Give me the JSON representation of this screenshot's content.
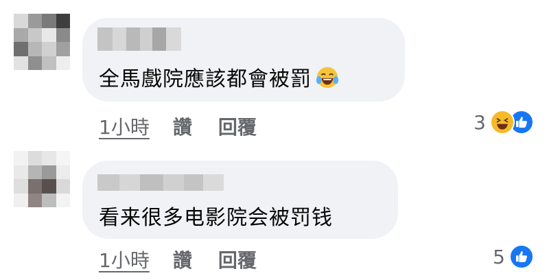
{
  "comments": [
    {
      "text": "全馬戲院應該都會被罰",
      "time": "1小時",
      "like_label": "讚",
      "reply_label": "回覆",
      "reaction_count": "3",
      "reactions": [
        "haha-icon",
        "like-icon"
      ],
      "inline_emoji": "laughing-tears-icon"
    },
    {
      "text": "看来很多电影院会被罚钱",
      "time": "1小時",
      "like_label": "讚",
      "reply_label": "回覆",
      "reaction_count": "5",
      "reactions": [
        "like-icon"
      ]
    }
  ],
  "colors": {
    "bubble": "#f0f2f5",
    "like": "#1877f2",
    "haha": "#f7b928",
    "meta_text": "#65676b"
  }
}
